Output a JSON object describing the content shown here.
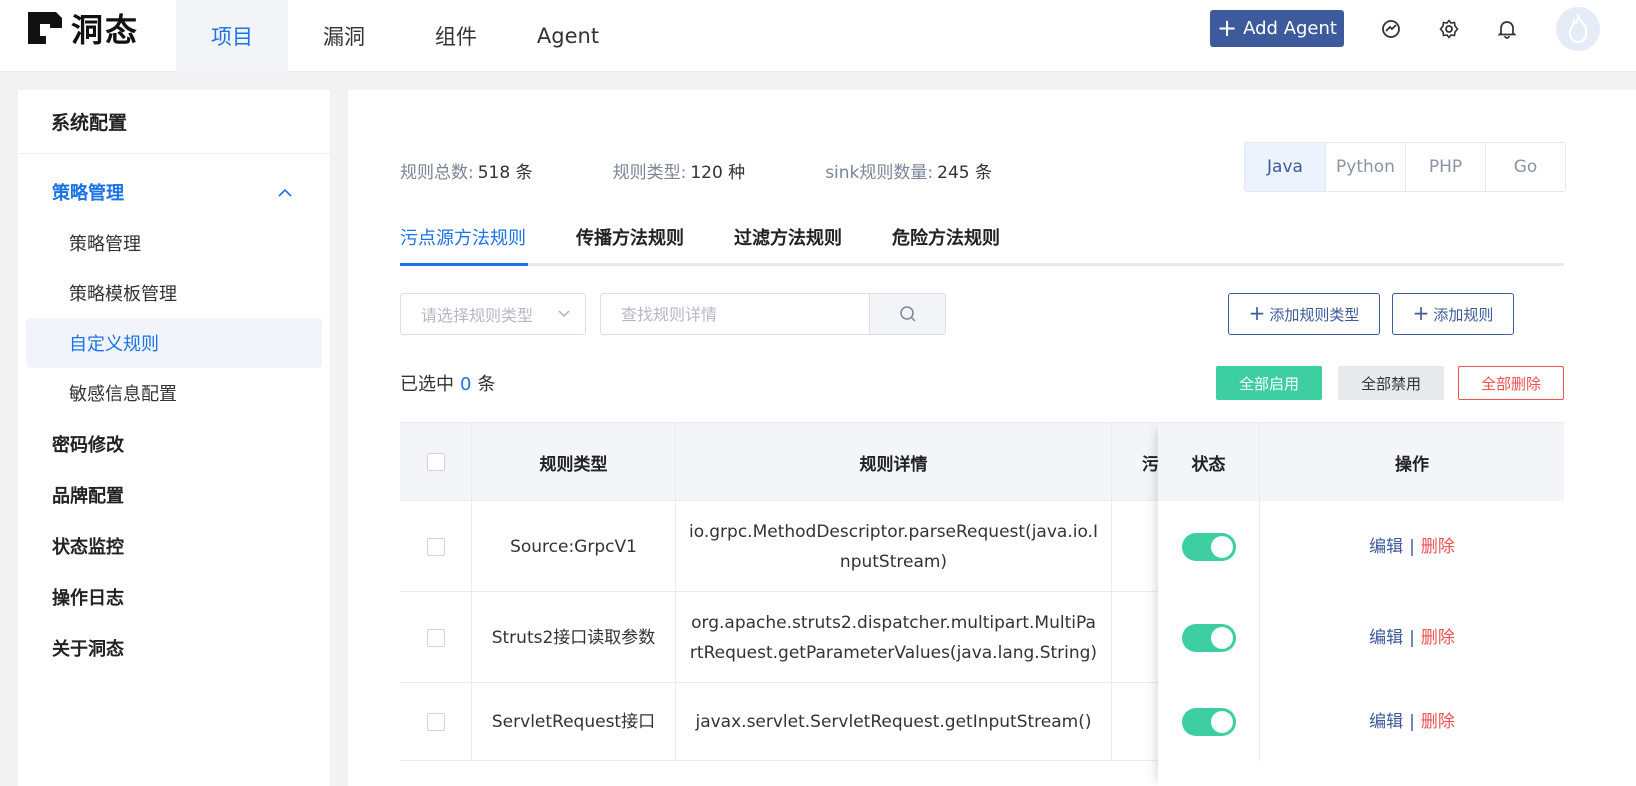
{
  "header": {
    "brand": "洞态",
    "nav": [
      {
        "label": "项目"
      },
      {
        "label": "漏洞"
      },
      {
        "label": "组件"
      },
      {
        "label": "Agent"
      }
    ],
    "add_agent_label": "Add Agent",
    "icons": [
      "dashboard-icon",
      "gear-icon",
      "bell-icon",
      "avatar"
    ]
  },
  "sidebar": {
    "title": "系统配置",
    "group": {
      "label": "策略管理",
      "expanded": true
    },
    "sub_items": [
      {
        "label": "策略管理"
      },
      {
        "label": "策略模板管理"
      },
      {
        "label": "自定义规则"
      },
      {
        "label": "敏感信息配置"
      }
    ],
    "items": [
      {
        "label": "密码修改"
      },
      {
        "label": "品牌配置"
      },
      {
        "label": "状态监控"
      },
      {
        "label": "操作日志"
      },
      {
        "label": "关于洞态"
      }
    ]
  },
  "stats": {
    "total_label": "规则总数:",
    "total_value": "518 条",
    "types_label": "规则类型:",
    "types_value": "120 种",
    "sink_label": "sink规则数量:",
    "sink_value": "245 条"
  },
  "languages": [
    {
      "label": "Java"
    },
    {
      "label": "Python"
    },
    {
      "label": "PHP"
    },
    {
      "label": "Go"
    }
  ],
  "rule_tabs": [
    {
      "label": "污点源方法规则"
    },
    {
      "label": "传播方法规则"
    },
    {
      "label": "过滤方法规则"
    },
    {
      "label": "危险方法规则"
    }
  ],
  "filters": {
    "type_placeholder": "请选择规则类型",
    "search_placeholder": "查找规则详情"
  },
  "buttons": {
    "add_rule_type": "添加规则类型",
    "add_rule": "添加规则",
    "enable_all": "全部启用",
    "disable_all": "全部禁用",
    "delete_all": "全部删除"
  },
  "selection": {
    "prefix": "已选中",
    "count": "0",
    "suffix": "条"
  },
  "table": {
    "headers": {
      "type": "规则类型",
      "detail": "规则详情",
      "partial": "污",
      "status": "状态",
      "action": "操作"
    },
    "rows": [
      {
        "type": "Source:GrpcV1",
        "detail": "io.grpc.MethodDescriptor.parseRequest(java.io.InputStream)",
        "enabled": true
      },
      {
        "type": "Struts2接口读取参数",
        "detail": "org.apache.struts2.dispatcher.multipart.MultiPartRequest.getParameterValues(java.lang.String)",
        "enabled": true
      },
      {
        "type": "ServletRequest接口",
        "detail": "javax.servlet.ServletRequest.getInputStream()",
        "enabled": true
      }
    ],
    "action_edit": "编辑",
    "action_sep": "|",
    "action_delete": "删除"
  },
  "colors": {
    "primary": "#3d5a9c",
    "accent_blue": "#1a73e8",
    "toggle_on": "#3ecfa0",
    "danger": "#f05050"
  }
}
